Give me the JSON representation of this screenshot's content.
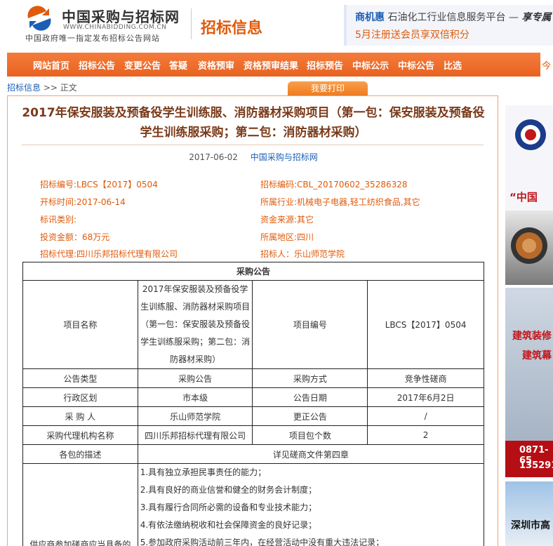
{
  "header": {
    "logo_cn": "中国采购与招标网",
    "logo_en": "WWW.CHINABIDDING.COM.CN",
    "logo_sub": "中国政府唯一指定发布招标公告网站",
    "section_title": "招标信息",
    "promo_brand": "商机惠",
    "promo_text": "石油化工行业信息服务平台 —",
    "promo_tail": "享专属",
    "promo_line2": "5月注册送会员享双倍积分"
  },
  "nav": {
    "items": [
      "网站首页",
      "招标公告",
      "变更公告",
      "答疑",
      "资格预审",
      "资格预审结果",
      "招标预告",
      "中标公示",
      "中标公告",
      "比选"
    ],
    "right": "今"
  },
  "breadcrumb": {
    "link": "招标信息",
    "sep": " >> ",
    "current": "正文"
  },
  "print_button": "我要打印",
  "article": {
    "title": "2017年保安服装及预备役学生训练服、消防器材采购项目（第一包：保安服装及预备役学生训练服采购；第二包：消防器材采购）",
    "date": "2017-06-02",
    "source": "中国采购与招标网",
    "meta": {
      "bid_no": "招标编号:LBCS【2017】0504",
      "bid_code": "招标编码:CBL_20170602_35286328",
      "open_time": "开标时间:2017-06-14",
      "industry": "所属行业:机械电子电器,轻工纺织食品,其它",
      "category": "标讯类别:",
      "fund_source": "资金来源:其它",
      "amount": "投资金额：68万元",
      "region": "所属地区:四川",
      "agent": "招标代理:四川乐邦招标代理有限公司",
      "tenderer": "招标人：乐山师范学院"
    }
  },
  "table": {
    "header": "采购公告",
    "project_name_label": "项目名称",
    "project_name": "2017年保安服装及预备役学生训练服、消防器材采购项目（第一包：保安服装及预备役学生训练服采购；第二包：消防器材采购）",
    "project_no_label": "项目编号",
    "project_no": "LBCS【2017】0504",
    "rows": [
      [
        "公告类型",
        "采购公告",
        "采购方式",
        "竞争性磋商"
      ],
      [
        "行政区划",
        "市本级",
        "公告日期",
        "2017年6月2日"
      ],
      [
        "采 购 人",
        "乐山师范学院",
        "更正公告",
        "/"
      ],
      [
        "采购代理机构名称",
        "四川乐邦招标代理有限公司",
        "项目包个数",
        "2"
      ]
    ],
    "desc_label": "各包的描述",
    "desc_value": "详见磋商文件第四章",
    "req_label": "供应商参加磋商应当具备的",
    "requirements": [
      "1.具有独立承担民事责任的能力；",
      "2.具有良好的商业信誉和健全的财务会计制度；",
      "3.具有履行合同所必需的设备和专业技术能力；",
      "4.有依法缴纳税收和社会保障资金的良好记录；",
      "5.参加政府采购活动前三年内，在经营活动中没有重大违法记录；"
    ]
  },
  "ads": {
    "ad1_text": "“中国",
    "ad2_line1": "建筑装修",
    "ad2_line2": "建筑幕",
    "ad2_phone1": "0871-65",
    "ad2_phone2": "135291",
    "ad3_text": "深圳市高"
  }
}
